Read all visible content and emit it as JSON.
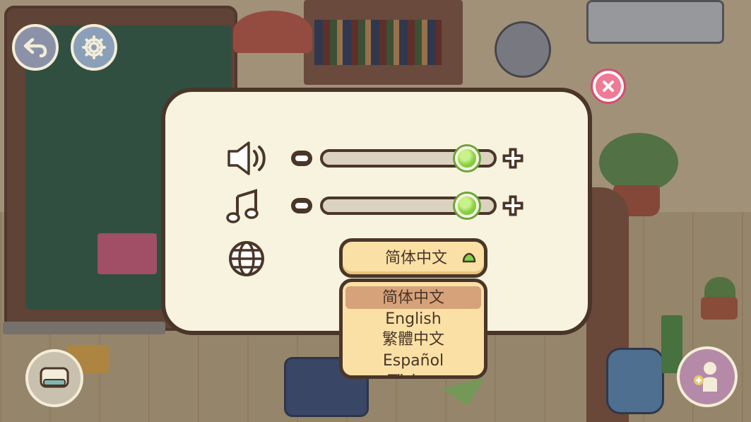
{
  "settings": {
    "sound": {
      "level": 0.93
    },
    "music": {
      "level": 0.93
    },
    "language": {
      "current": "简体中文",
      "options": [
        "简体中文",
        "English",
        "繁體中文",
        "Español",
        "Türkçe"
      ],
      "highlighted_index": 0
    }
  },
  "icons": {
    "back": "back-arrow-icon",
    "settings": "gear-icon",
    "close": "close-icon",
    "sound": "speaker-icon",
    "music": "music-note-icon",
    "language": "globe-icon",
    "dropdown": "chevron-up-icon"
  },
  "colors": {
    "panel_bg": "#f7f3df",
    "panel_border": "#4a3628",
    "slider_knob": "#8ad448",
    "dropdown_bg": "#fbe0a6",
    "highlight": "#d6a27a",
    "close_accent": "#ef7a95"
  }
}
